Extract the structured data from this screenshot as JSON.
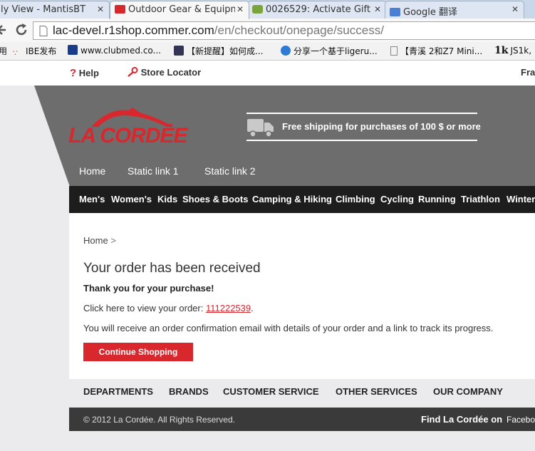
{
  "browser": {
    "tabs": [
      {
        "label": "ly View - MantisBT",
        "close": "✕"
      },
      {
        "label": "Outdoor Gear & Equipm",
        "close": "✕"
      },
      {
        "label": "0026529: Activate Gift C",
        "close": "✕"
      },
      {
        "label": "Google 翻译",
        "close": "✕"
      }
    ],
    "url_host": "lac-devel.r1shop.commer.com",
    "url_path": "/en/checkout/onepage/success/",
    "bookmarks": [
      {
        "prefix": "用",
        "label": ""
      },
      {
        "label": "IBE发布"
      },
      {
        "label": "www.clubmed.co..."
      },
      {
        "label": "【新提醒】如何成..."
      },
      {
        "label": "分享一个基于ligeru..."
      },
      {
        "label": "【青溪 2和Z7 Mini..."
      },
      {
        "label": "JS1k,"
      }
    ],
    "bookmark_1k": "1k"
  },
  "topbar": {
    "help": "Help",
    "store_locator": "Store Locator",
    "lang": "Fra"
  },
  "header": {
    "logo_text": "LA CORDÉE",
    "shipping": "Free shipping for purchases of 100 $ or more",
    "links": [
      "Home",
      "Static link 1",
      "Static link 2"
    ]
  },
  "nav": {
    "items": [
      "Men's",
      "Women's",
      "Kids",
      "Shoes & Boots",
      "Camping & Hiking",
      "Climbing",
      "Cycling",
      "Running",
      "Triathlon",
      "Winter"
    ]
  },
  "content": {
    "breadcrumb": "Home",
    "breadcrumb_sep": ">",
    "heading": "Your order has been received",
    "thanks": "Thank you for your purchase!",
    "view_order_prefix": "Click here to view your order:",
    "order_number": "111222539",
    "view_order_suffix": ".",
    "confirmation": "You will receive an order confirmation email with details of your order and a link to track its progress.",
    "continue_button": "Continue Shopping"
  },
  "footer": {
    "links": [
      "DEPARTMENTS",
      "BRANDS",
      "CUSTOMER SERVICE",
      "OTHER SERVICES",
      "OUR COMPANY"
    ],
    "copyright": "© 2012 La Cordée. All Rights Reserved.",
    "find_on": "Find La Cordée on",
    "facebook": "Facebo"
  },
  "colors": {
    "brand_red": "#d9272e",
    "header_gray": "#6d6d6d",
    "nav_black": "#1d1d1d",
    "footer_dark": "#3a3a3a"
  }
}
